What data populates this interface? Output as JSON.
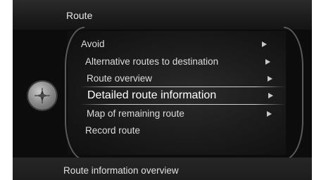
{
  "header": {
    "title": "Route"
  },
  "menu": {
    "items": [
      {
        "label": "Avoid",
        "has_submenu": true
      },
      {
        "label": "Alternative routes to destination",
        "has_submenu": true
      },
      {
        "label": "Route overview",
        "has_submenu": true
      },
      {
        "label": "Detailed route information",
        "has_submenu": true,
        "selected": true
      },
      {
        "label": "Map of remaining route",
        "has_submenu": true
      },
      {
        "label": "Record route",
        "has_submenu": false
      }
    ]
  },
  "footer": {
    "label": "Route information overview"
  },
  "icons": {
    "nav_knob": "navigation-compass-icon",
    "submenu_arrow": "triangle-right-icon"
  }
}
